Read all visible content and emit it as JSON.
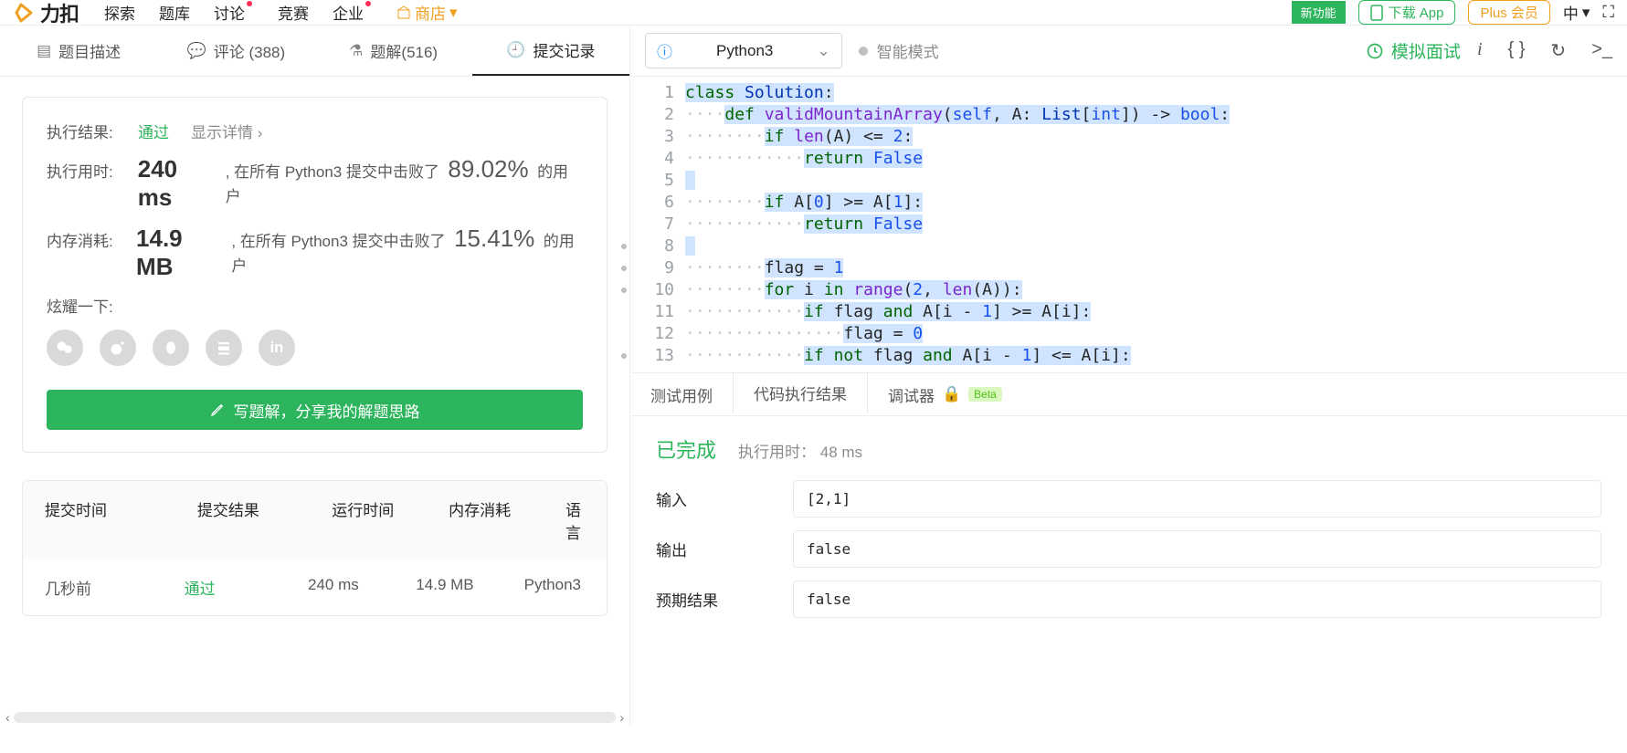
{
  "colors": {
    "accent_green": "#2db55d",
    "accent_orange": "#f0a020"
  },
  "topbar": {
    "logo_text": "力扣",
    "nav": [
      "探索",
      "题库",
      "讨论",
      "竞赛",
      "企业",
      "商店"
    ],
    "flag": "新功能",
    "download": "下载 App",
    "plus": "Plus 会员",
    "lang": "中"
  },
  "left_tabs": {
    "desc": "题目描述",
    "comments": "评论 (388)",
    "solutions": "题解(516)",
    "submissions": "提交记录"
  },
  "result": {
    "label_result": "执行结果:",
    "pass": "通过",
    "detail": "显示详情",
    "label_time": "执行用时:",
    "time_value": "240 ms",
    "time_tail_a": ", 在所有 Python3 提交中击败了",
    "time_pct": "89.02%",
    "time_tail_b": "的用户",
    "label_mem": "内存消耗:",
    "mem_value": "14.9 MB",
    "mem_tail_a": ", 在所有 Python3 提交中击败了",
    "mem_pct": "15.41%",
    "mem_tail_b": "的用户",
    "brag": "炫耀一下:",
    "write_btn": "写题解，分享我的解题思路"
  },
  "sub_table": {
    "headers": [
      "提交时间",
      "提交结果",
      "运行时间",
      "内存消耗",
      "语言"
    ],
    "row": {
      "time": "几秒前",
      "result": "通过",
      "runtime": "240 ms",
      "memory": "14.9 MB",
      "lang": "Python3"
    }
  },
  "right_toolbar": {
    "language": "Python3",
    "mode": "智能模式",
    "mock": "模拟面试"
  },
  "code": {
    "lines": [
      "class Solution:",
      "    def validMountainArray(self, A: List[int]) -> bool:",
      "        if len(A) <= 2:",
      "            return False",
      "",
      "        if A[0] >= A[1]:",
      "            return False",
      "",
      "        flag = 1",
      "        for i in range(2, len(A)):",
      "            if flag and A[i - 1] >= A[i]:",
      "                flag = 0",
      "            if not flag and A[i - 1] <= A[i]:"
    ]
  },
  "rbtabs": {
    "testcases": "测试用例",
    "result": "代码执行结果",
    "debugger": "调试器",
    "beta": "Beta"
  },
  "exec": {
    "done": "已完成",
    "runtime_label": "执行用时：",
    "runtime_value": "48 ms",
    "input_label": "输入",
    "input_value": "[2,1]",
    "output_label": "输出",
    "output_value": "false",
    "expected_label": "预期结果",
    "expected_value": "false"
  }
}
